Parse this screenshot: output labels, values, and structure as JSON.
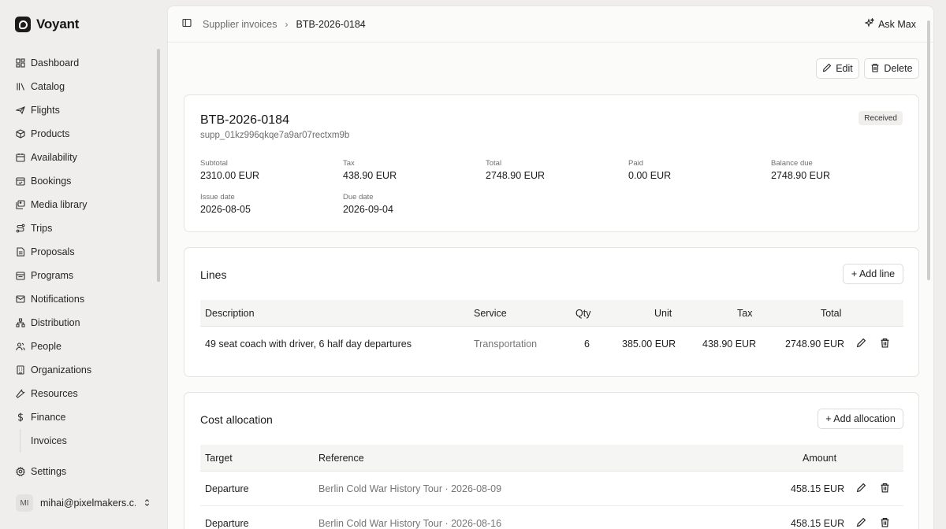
{
  "brand": {
    "name": "Voyant"
  },
  "sidebar": {
    "items": [
      {
        "label": "Dashboard",
        "icon": "dashboard-icon"
      },
      {
        "label": "Catalog",
        "icon": "library-icon"
      },
      {
        "label": "Flights",
        "icon": "plane-icon"
      },
      {
        "label": "Products",
        "icon": "box-icon"
      },
      {
        "label": "Availability",
        "icon": "calendar-icon"
      },
      {
        "label": "Bookings",
        "icon": "calendar-check-icon"
      },
      {
        "label": "Media library",
        "icon": "images-icon"
      },
      {
        "label": "Trips",
        "icon": "route-icon"
      },
      {
        "label": "Proposals",
        "icon": "file-text-icon"
      },
      {
        "label": "Programs",
        "icon": "calendar-range-icon"
      },
      {
        "label": "Notifications",
        "icon": "mail-icon"
      },
      {
        "label": "Distribution",
        "icon": "network-icon"
      },
      {
        "label": "People",
        "icon": "users-icon"
      },
      {
        "label": "Organizations",
        "icon": "building-icon"
      },
      {
        "label": "Resources",
        "icon": "wrench-icon"
      },
      {
        "label": "Finance",
        "icon": "dollar-icon"
      }
    ],
    "sub_items": [
      {
        "label": "Invoices"
      }
    ],
    "settings": {
      "label": "Settings",
      "icon": "gear-icon"
    },
    "user": {
      "initials": "MI",
      "email": "mihai@pixelmakers.c..."
    }
  },
  "breadcrumb": {
    "parent": "Supplier invoices",
    "current": "BTB-2026-0184"
  },
  "header": {
    "ask_label": "Ask Max"
  },
  "actions": {
    "edit_label": "Edit",
    "delete_label": "Delete"
  },
  "invoice": {
    "number": "BTB-2026-0184",
    "supplier_id": "supp_01kz996qkqe7a9ar07rectxm9b",
    "status": "Received",
    "stats": [
      {
        "label": "Subtotal",
        "value": "2310.00 EUR"
      },
      {
        "label": "Tax",
        "value": "438.90 EUR"
      },
      {
        "label": "Total",
        "value": "2748.90 EUR"
      },
      {
        "label": "Paid",
        "value": "0.00 EUR"
      },
      {
        "label": "Balance due",
        "value": "2748.90 EUR"
      },
      {
        "label": "Issue date",
        "value": "2026-08-05"
      },
      {
        "label": "Due date",
        "value": "2026-09-04"
      }
    ]
  },
  "lines": {
    "title": "Lines",
    "add_label": "+ Add line",
    "columns": [
      "Description",
      "Service",
      "Qty",
      "Unit",
      "Tax",
      "Total"
    ],
    "rows": [
      {
        "description": "49 seat coach with driver, 6 half day departures",
        "service": "Transportation",
        "qty": "6",
        "unit": "385.00 EUR",
        "tax": "438.90 EUR",
        "total": "2748.90 EUR"
      }
    ]
  },
  "allocation": {
    "title": "Cost allocation",
    "add_label": "+ Add allocation",
    "columns": [
      "Target",
      "Reference",
      "Amount"
    ],
    "rows": [
      {
        "target": "Departure",
        "reference": "Berlin Cold War History Tour · 2026-08-09",
        "amount": "458.15 EUR"
      },
      {
        "target": "Departure",
        "reference": "Berlin Cold War History Tour · 2026-08-16",
        "amount": "458.15 EUR"
      }
    ]
  }
}
